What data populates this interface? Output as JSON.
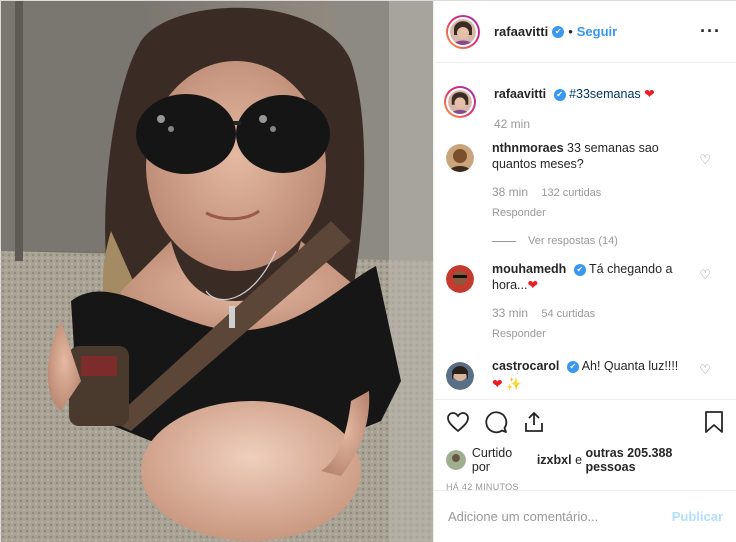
{
  "header": {
    "username": "rafaavitti",
    "verified": true,
    "follow_label": "Seguir",
    "more_icon": "ellipsis-icon"
  },
  "caption": {
    "username": "rafaavitti",
    "text": "#33semanas",
    "emoji": "❤",
    "time": "42 min"
  },
  "comments": [
    {
      "username": "nthnmoraes",
      "verified": false,
      "text": "33 semanas sao quantos meses?",
      "time": "38 min",
      "likes": "132 curtidas",
      "reply": "Responder",
      "view_replies": "Ver respostas (14)"
    },
    {
      "username": "mouhamedh",
      "verified": true,
      "text": "Tá chegando a hora...",
      "emoji": "❤",
      "time": "33 min",
      "likes": "54 curtidas",
      "reply": "Responder"
    },
    {
      "username": "castrocarol",
      "verified": true,
      "text": "Ah! Quanta luz!!!!",
      "emoji": "❤ ✨"
    }
  ],
  "likes": {
    "prefix": "Curtido por",
    "user": "izxbxl",
    "middle": "e",
    "others": "outras 205.388 pessoas"
  },
  "timestamp": "HÁ 42 MINUTOS",
  "add_comment": {
    "placeholder": "Adicione um comentário...",
    "publish_label": "Publicar"
  },
  "colors": {
    "accent": "#3897f0",
    "heart": "#ed1c24",
    "publish_disabled": "#b2dffc"
  }
}
